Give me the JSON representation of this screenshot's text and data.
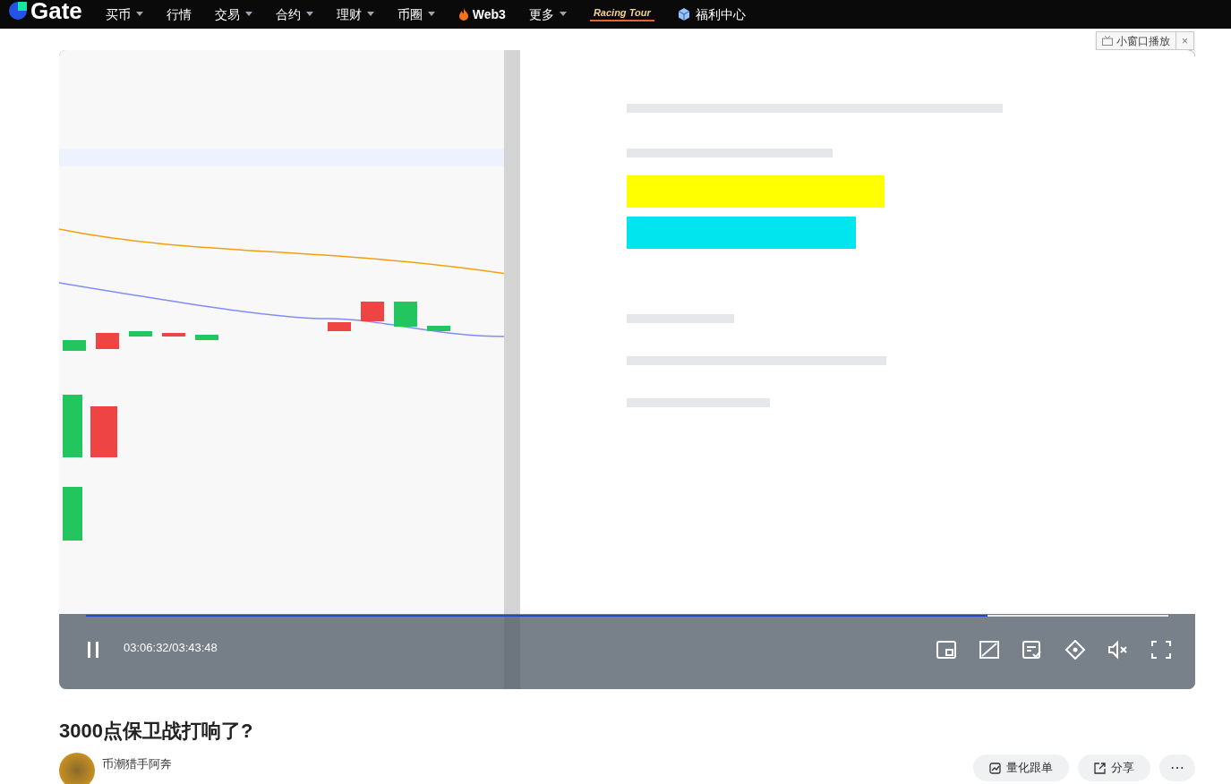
{
  "nav": {
    "logo": "Gate",
    "items": [
      {
        "label": "买币",
        "kind": "menu"
      },
      {
        "label": "行情",
        "kind": "plain"
      },
      {
        "label": "交易",
        "kind": "menu"
      },
      {
        "label": "合约",
        "kind": "menu"
      },
      {
        "label": "理财",
        "kind": "menu"
      },
      {
        "label": "币圈",
        "kind": "menu"
      },
      {
        "label": "Web3",
        "kind": "fire"
      },
      {
        "label": "更多",
        "kind": "menu"
      },
      {
        "label": "Racing Tour",
        "kind": "banner"
      },
      {
        "label": "福利中心",
        "kind": "gift"
      }
    ]
  },
  "mini_player": {
    "label": "小窗口播放",
    "close": "×"
  },
  "video": {
    "kind": "picture",
    "time": "03:06:32/03:43:48",
    "playing": true,
    "muted": true,
    "progress": {
      "level": 0.833
    }
  },
  "title": "3000点保卫战打响了?",
  "author": {
    "name": "币潮猎手阿奔"
  },
  "actions": [
    {
      "label": "量化跟单",
      "kind": "quant"
    },
    {
      "label": "分享",
      "kind": "share"
    },
    {
      "label": "⋯",
      "kind": "more"
    }
  ]
}
